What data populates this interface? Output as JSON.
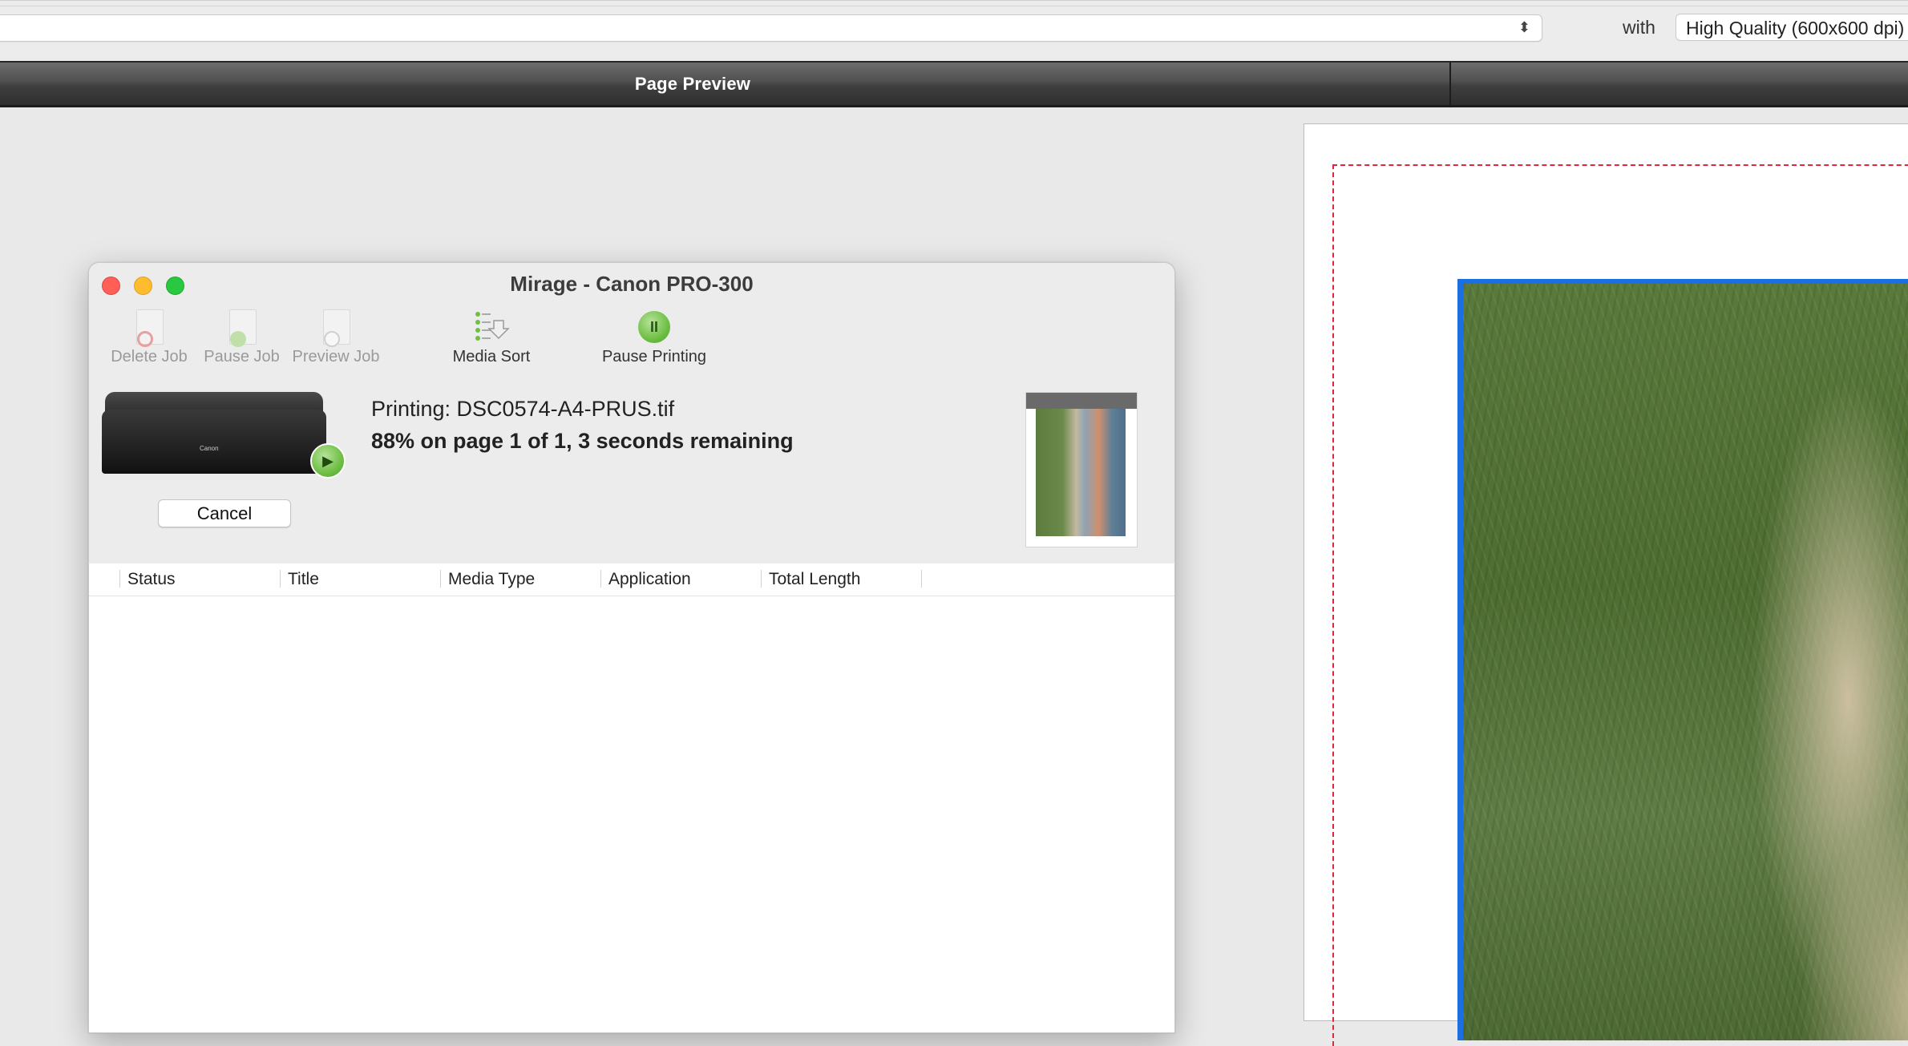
{
  "toolbar": {
    "profile_value": "",
    "with_label": "with",
    "quality_value": "High Quality (600x600 dpi)"
  },
  "header": {
    "title": "Page Preview"
  },
  "window": {
    "title": "Mirage - Canon PRO-300",
    "tools": {
      "delete_job": "Delete Job",
      "pause_job": "Pause Job",
      "preview_job": "Preview Job",
      "media_sort": "Media Sort",
      "pause_printing": "Pause Printing"
    },
    "status": {
      "file_line": "Printing: DSC0574-A4-PRUS.tif",
      "progress_line": "88% on page 1 of 1, 3 seconds remaining",
      "progress_percent": 88,
      "cancel_label": "Cancel",
      "printer_brand": "Canon"
    },
    "table": {
      "columns": [
        "Status",
        "Title",
        "Media Type",
        "Application",
        "Total Length"
      ],
      "rows": []
    }
  },
  "colors": {
    "accent_selection": "#1b6fe0",
    "margin_guide": "#e0283c",
    "close": "#fe5f57",
    "minimize": "#febc2e",
    "zoom": "#28c840"
  }
}
